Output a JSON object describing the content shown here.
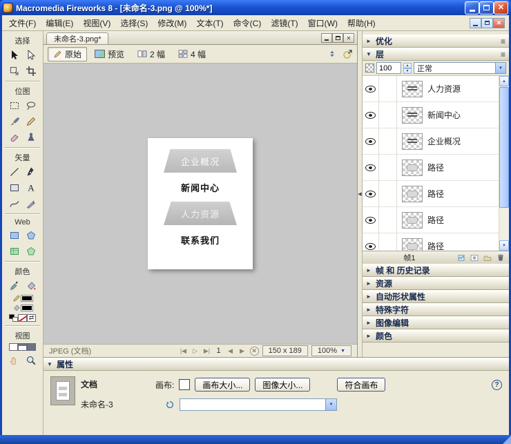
{
  "titlebar": {
    "title": "Macromedia Fireworks 8 - [未命名-3.png @ 100%*]"
  },
  "menubar": {
    "items": [
      "文件(F)",
      "编辑(E)",
      "视图(V)",
      "选择(S)",
      "修改(M)",
      "文本(T)",
      "命令(C)",
      "滤镜(T)",
      "窗口(W)",
      "帮助(H)"
    ]
  },
  "tools": {
    "select_label": "选择",
    "bitmap_label": "位图",
    "vector_label": "矢量",
    "web_label": "Web",
    "colors_label": "颜色",
    "view_label": "视图"
  },
  "doc": {
    "tab": "未命名-3.png*",
    "btn_original": "原始",
    "btn_preview": "预览",
    "btn_2up": "2 幅",
    "btn_4up": "4 幅",
    "menu_items": [
      "企业概况",
      "新闻中心",
      "人力资源",
      "联系我们"
    ],
    "status": {
      "format": "JPEG (文档)",
      "frame": "1",
      "size": "150 x 189",
      "zoom": "100%"
    }
  },
  "panels": {
    "optimize_label": "优化",
    "layers": {
      "title": "层",
      "opacity": "100",
      "blend": "正常",
      "frame_label": "帧1",
      "rows": [
        {
          "name": "人力资源"
        },
        {
          "name": "新闻中心"
        },
        {
          "name": "企业概况"
        },
        {
          "name": "路径"
        },
        {
          "name": "路径"
        },
        {
          "name": "路径"
        },
        {
          "name": "路径"
        }
      ]
    },
    "collapsed": [
      "帧 和 历史记录",
      "资源",
      "自动形状属性",
      "特殊字符",
      "图像编辑",
      "颜色"
    ]
  },
  "properties": {
    "title": "属性",
    "doc_type": "文档",
    "doc_name": "未命名-3",
    "canvas_label": "画布:",
    "btn_canvas_size": "画布大小...",
    "btn_image_size": "图像大小...",
    "btn_fit_canvas": "符合画布",
    "help": "?"
  },
  "icons": {
    "expand": "▼",
    "collapse": "►",
    "splitter": "◀",
    "combo_arrow": "▼",
    "spin_up": "▲",
    "spin_down": "▼",
    "scroll_up": "▲",
    "scroll_down": "▼",
    "first_frame": "|◀",
    "play": "▷",
    "last_frame": "▶|",
    "prev_frame": "◀",
    "next_frame": "▶",
    "stop": "✕",
    "close": "✕",
    "panel_menu": "≡",
    "swap": "⇄"
  },
  "colors": {
    "titlebar_blue": "#1c55d4",
    "panel_bg": "#ece9d8",
    "canvas_gray": "#c8c8c8",
    "accent_blue": "#316ac5",
    "nav_item_gray": "#c2c2c2"
  }
}
